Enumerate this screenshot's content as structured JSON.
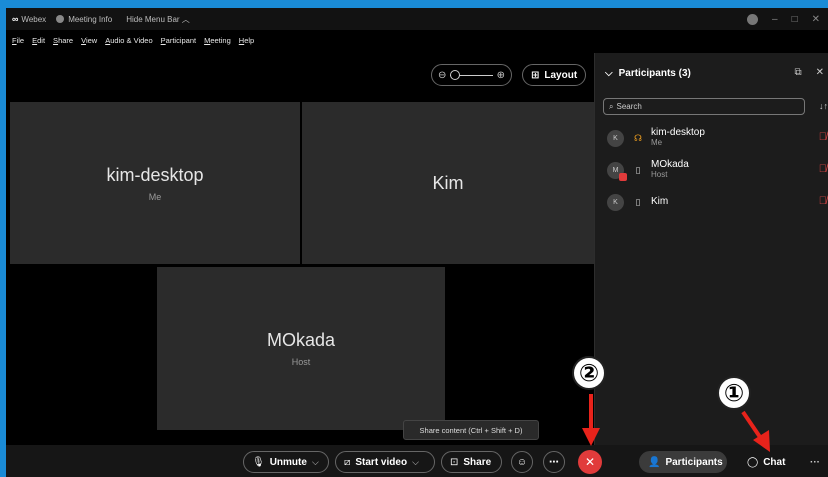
{
  "titlebar": {
    "app": "Webex",
    "meeting_info": "Meeting Info",
    "hide_menu": "Hide Menu Bar"
  },
  "menu": [
    "File",
    "Edit",
    "Share",
    "View",
    "Audio & Video",
    "Participant",
    "Meeting",
    "Help"
  ],
  "controls": {
    "layout": "Layout"
  },
  "tiles": [
    {
      "name": "kim-desktop",
      "role": "Me"
    },
    {
      "name": "Kim",
      "role": ""
    },
    {
      "name": "MOkada",
      "role": "Host"
    }
  ],
  "panel": {
    "title": "Participants (3)",
    "search_placeholder": "Search",
    "participants": [
      {
        "initial": "K",
        "name": "kim-desktop",
        "role": "Me"
      },
      {
        "initial": "M",
        "name": "MOkada",
        "role": "Host"
      },
      {
        "initial": "K",
        "name": "Kim",
        "role": ""
      }
    ]
  },
  "tooltip": "Share content (Ctrl + Shift + D)",
  "toolbar": {
    "unmute": "Unmute",
    "start_video": "Start video",
    "share": "Share",
    "participants": "Participants",
    "chat": "Chat",
    "more": "···"
  },
  "annotations": {
    "one": "①",
    "two": "②"
  },
  "colors": {
    "end_call": "#e13b3b",
    "annotation_arrow": "#e8231b",
    "frame_border": "#1a8bd6"
  }
}
